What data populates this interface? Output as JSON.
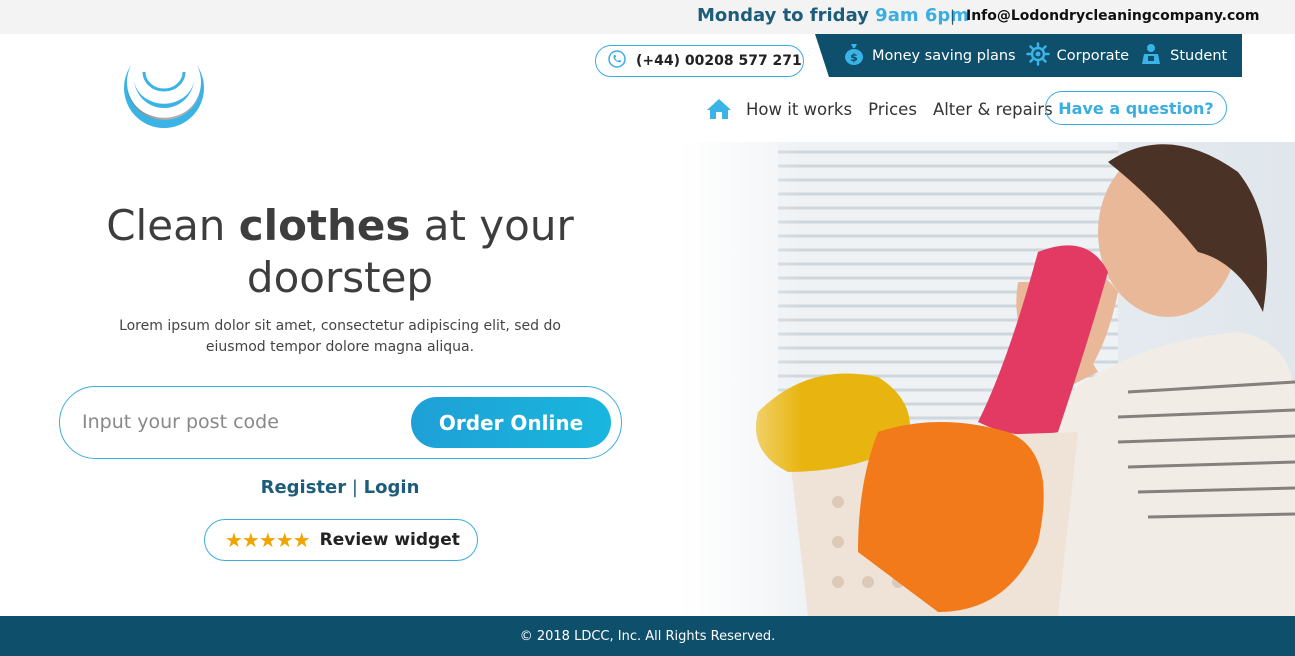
{
  "topbar": {
    "hours_prefix": "Monday to friday ",
    "hours_time": "9am 6pm",
    "separator": "|",
    "email": "Info@Lodondrycleaningcompany.com"
  },
  "header": {
    "phone": "(+44) 00208 577 271",
    "plans": [
      {
        "label": "Money saving plans",
        "icon": "money-bag-icon"
      },
      {
        "label": "Corporate",
        "icon": "gear-icon"
      },
      {
        "label": "Student",
        "icon": "student-icon"
      }
    ],
    "nav": {
      "home_icon": "home-icon",
      "links": [
        "How it works",
        "Prices",
        "Alter & repairs"
      ],
      "question_button": "Have a question?"
    }
  },
  "hero": {
    "headline_1": "Clean ",
    "headline_bold": "clothes",
    "headline_2": " at your",
    "headline_3": "doorstep",
    "subtext": "Lorem ipsum dolor sit amet, consectetur adipiscing elit, sed do eiusmod tempor dolore magna aliqua.",
    "postcode_placeholder": "Input your post code",
    "order_button": "Order Online",
    "register": "Register",
    "auth_separator": "|",
    "login": "Login",
    "review_stars": "★★★★★",
    "review_label": "Review widget"
  },
  "footer": {
    "copyright": "© 2018 LDCC, Inc. All Rights Reserved."
  },
  "colors": {
    "brand_dark": "#0e4f6b",
    "accent": "#3aaee0",
    "star": "#f0a400"
  }
}
